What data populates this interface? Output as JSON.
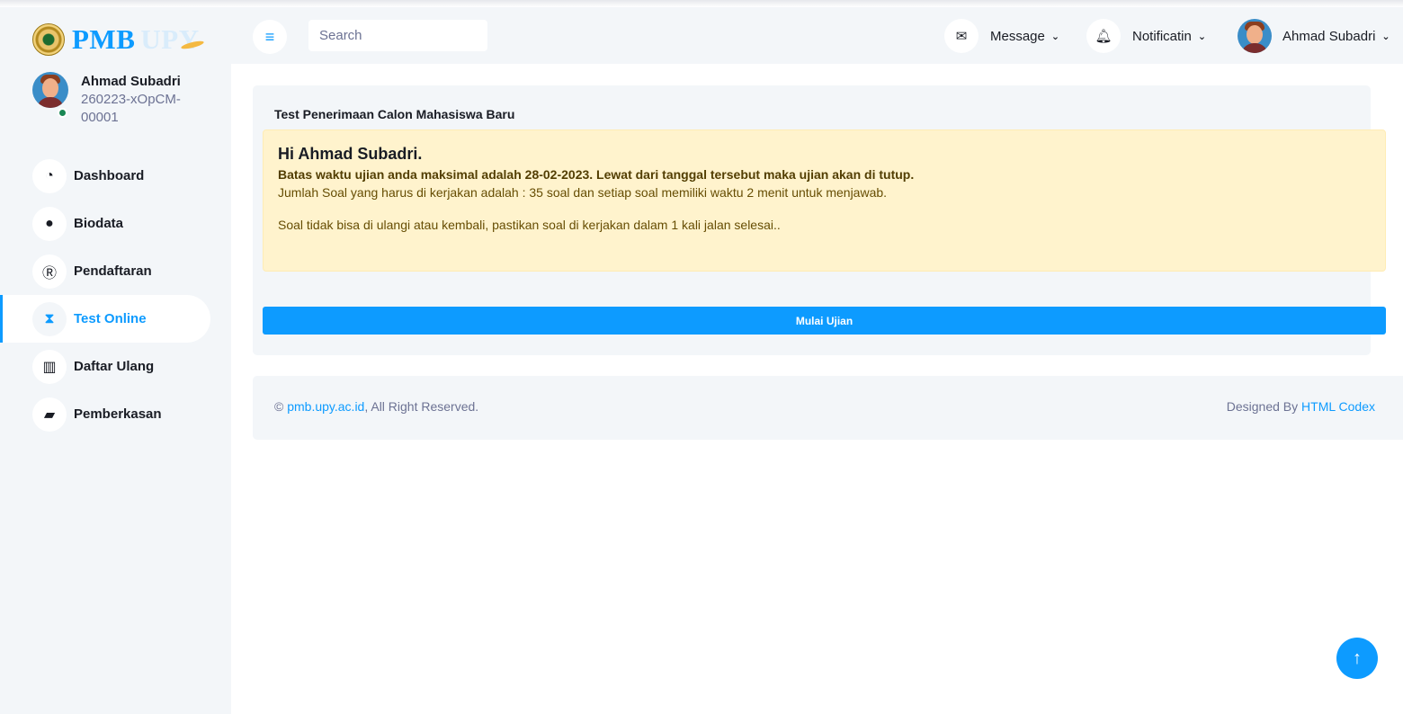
{
  "brand": {
    "name": "PMB",
    "suffix": "UPY",
    "logo_icon": "university-seal-icon"
  },
  "user": {
    "name": "Ahmad Subadri",
    "id": "260223-xOpCM-00001",
    "status_color": "#198754"
  },
  "sidebar": {
    "items": [
      {
        "label": "Dashboard",
        "icon": "tachometer-icon",
        "glyph": "◔",
        "active": false
      },
      {
        "label": "Biodata",
        "icon": "user-icon",
        "glyph": "●",
        "active": false
      },
      {
        "label": "Pendaftaran",
        "icon": "registered-icon",
        "glyph": "Ⓡ",
        "active": false
      },
      {
        "label": "Test Online",
        "icon": "hourglass-icon",
        "glyph": "⧗",
        "active": true
      },
      {
        "label": "Daftar Ulang",
        "icon": "chart-bar-icon",
        "glyph": "▥",
        "active": false
      },
      {
        "label": "Pemberkasan",
        "icon": "folder-open-icon",
        "glyph": "▰",
        "active": false
      }
    ]
  },
  "topbar": {
    "search_placeholder": "Search",
    "message_label": "Message",
    "notification_label": "Notificatin",
    "user_label": "Ahmad Subadri"
  },
  "card": {
    "title": "Test Penerimaan Calon Mahasiswa Baru",
    "greeting": "Hi Ahmad Subadri.",
    "deadline_text": "Batas waktu ujian anda maksimal adalah 28-02-2023. Lewat dari tanggal tersebut maka ujian akan di tutup.",
    "questions_text": "Jumlah Soal yang harus di kerjakan adalah : 35 soal dan setiap soal memiliki waktu 2 menit untuk menjawab.",
    "warning_text": "Soal tidak bisa di ulangi atau kembali, pastikan soal di kerjakan dalam 1 kali jalan selesai..",
    "start_button": "Mulai Ujian"
  },
  "footer": {
    "copyright_symbol": "©",
    "site_link": "pmb.upy.ac.id",
    "rights_text": ", All Right Reserved.",
    "designed_by": "Designed By",
    "designer_link": "HTML Codex"
  },
  "colors": {
    "accent": "#0d9bff",
    "panel": "#f3f6f9",
    "alert_bg": "#fff3cd"
  }
}
